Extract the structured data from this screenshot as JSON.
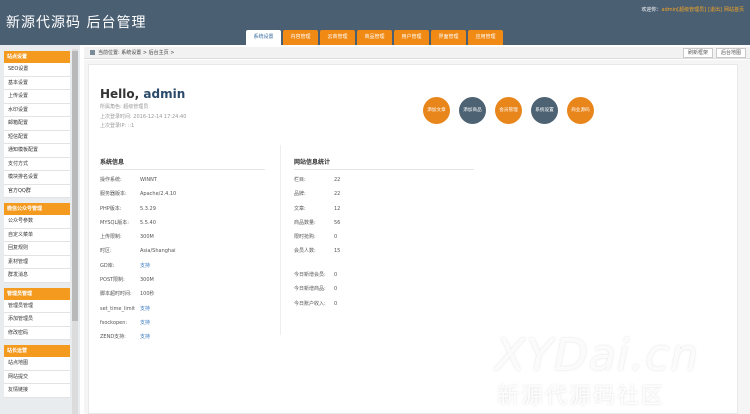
{
  "header": {
    "logo": "新源代源码 后台管理",
    "welcome": "欢迎你：",
    "user": "admin",
    "role": "[超级管理员]",
    "logout": "[退出]",
    "home": "网站首页",
    "tabs": [
      "系统设置",
      "内容管理",
      "云商管理",
      "商品管理",
      "用户管理",
      "界面管理",
      "应用管理"
    ]
  },
  "breadcrumb": {
    "text": "当前位置: 系统设置 > 后台主页 >",
    "refresh": "刷新框架",
    "map": "后台地图"
  },
  "sidebar": {
    "groups": [
      {
        "title": "站点设置",
        "items": [
          "SEO设置",
          "基本设置",
          "上传设置",
          "水印设置",
          "邮箱配置",
          "短信配置",
          "通知模板配置",
          "支付方式",
          "模块排名设置",
          "官方QQ群"
        ]
      },
      {
        "title": "微信公众号管理",
        "items": [
          "公众号参数",
          "自定义菜单",
          "回复规则",
          "素材管理",
          "群发消息"
        ]
      },
      {
        "title": "管理员管理",
        "items": [
          "管理员管理",
          "添加管理员",
          "修改密码"
        ]
      },
      {
        "title": "站长运营",
        "items": [
          "站点地图",
          "网站提交",
          "友情链接"
        ]
      }
    ]
  },
  "main": {
    "hello": "Hello,",
    "username": "admin",
    "meta": [
      "所属角色: 超级管理员",
      "上次登录时间: 2016-12-14 17:24:40",
      "上次登录IP: ::1"
    ],
    "actions": [
      {
        "label": "添加文章",
        "color": "#e8861b"
      },
      {
        "label": "添加商品",
        "color": "#4d6272"
      },
      {
        "label": "会员管理",
        "color": "#e8861b"
      },
      {
        "label": "系统设置",
        "color": "#4d6272"
      },
      {
        "label": "商业源码",
        "color": "#e8861b"
      }
    ],
    "sysinfo": {
      "title": "系统信息",
      "rows": [
        {
          "k": "操作系统:",
          "v": "WINNT"
        },
        {
          "k": "服务器版本:",
          "v": "Apache/2.4.10"
        },
        {
          "k": "PHP版本:",
          "v": "5.3.29"
        },
        {
          "k": "MYSQL版本:",
          "v": "5.5.40"
        },
        {
          "k": "上传限制:",
          "v": "300M"
        },
        {
          "k": "时区:",
          "v": "Asia/Shanghai"
        },
        {
          "k": "GD库:",
          "v": "支持"
        },
        {
          "k": "POST限制:",
          "v": "300M"
        },
        {
          "k": "脚本超时时间:",
          "v": "100秒"
        },
        {
          "k": "set_time_limit",
          "v": "支持"
        },
        {
          "k": "fsockopen:",
          "v": "支持"
        },
        {
          "k": "ZEND支持:",
          "v": "支持"
        }
      ]
    },
    "stats": {
      "title": "网站信息统计",
      "rows": [
        {
          "k": "栏目:",
          "v": "22"
        },
        {
          "k": "品牌:",
          "v": "22"
        },
        {
          "k": "文章:",
          "v": "12"
        },
        {
          "k": "商品数量:",
          "v": "56"
        },
        {
          "k": "限时抢购:",
          "v": "0"
        },
        {
          "k": "会员人数:",
          "v": "15"
        }
      ],
      "today": [
        {
          "k": "今日新增会员:",
          "v": "0"
        },
        {
          "k": "今日新增商品:",
          "v": "0"
        },
        {
          "k": "今日账户收入:",
          "v": "0"
        }
      ]
    }
  },
  "watermark": {
    "en": "XYDai.cn",
    "cn": "新源代源码社区"
  }
}
